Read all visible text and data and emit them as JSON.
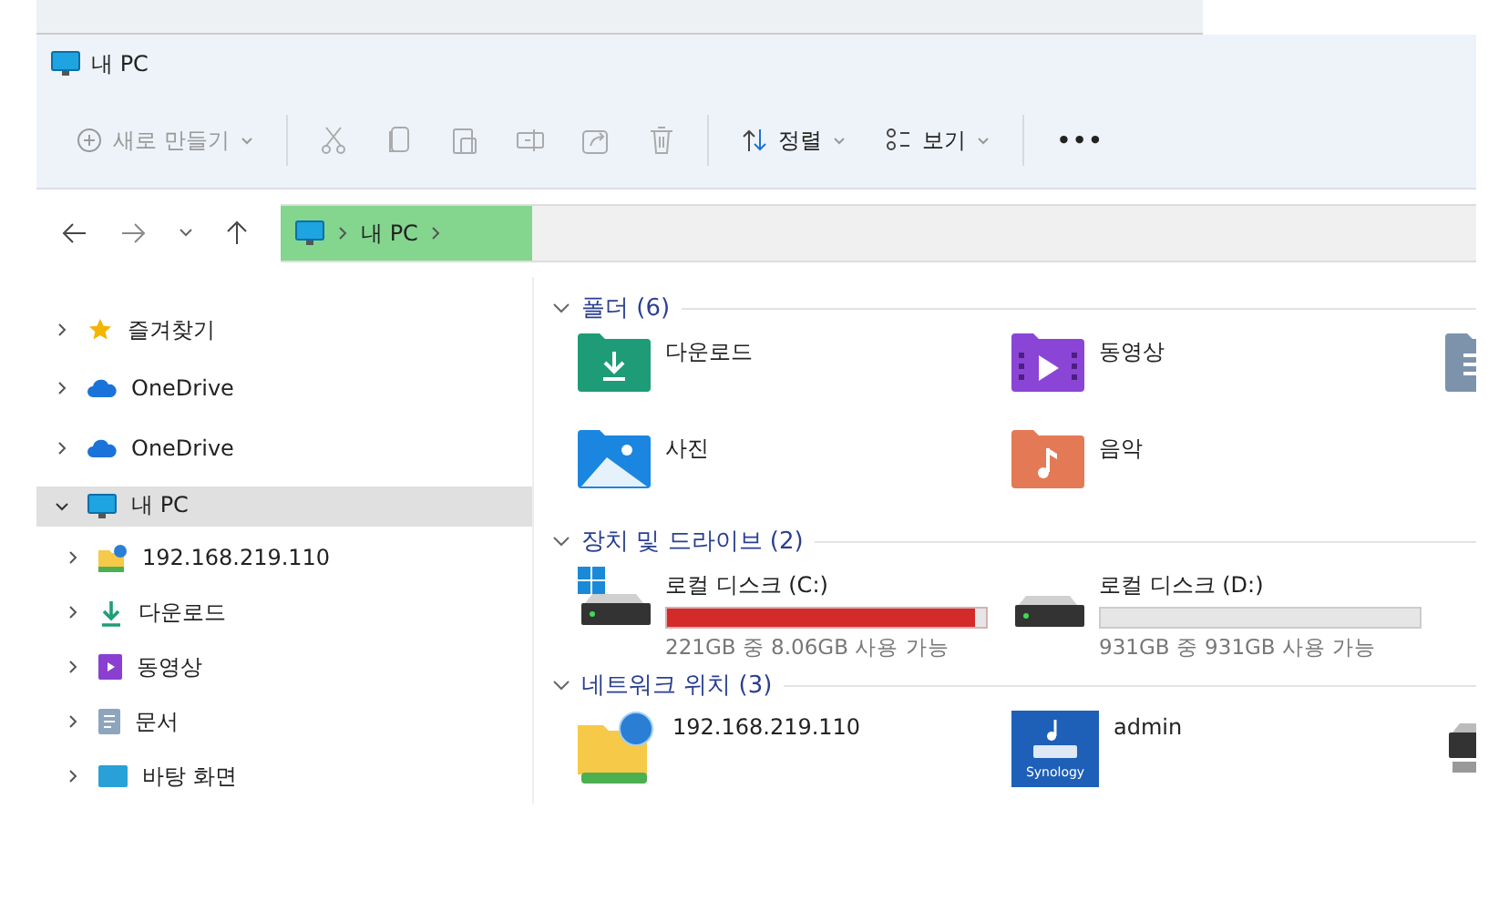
{
  "window": {
    "title": "내 PC"
  },
  "toolbar": {
    "new_button": "새로 만들기",
    "sort_button": "정렬",
    "view_button": "보기",
    "more_button": "•••"
  },
  "address_bar": {
    "path": [
      "내 PC"
    ]
  },
  "sidebar": {
    "items": [
      {
        "label": "즐겨찾기",
        "kind": "star",
        "expanded": false,
        "selected": false
      },
      {
        "label": "OneDrive",
        "kind": "cloud",
        "expanded": false,
        "selected": false
      },
      {
        "label": "OneDrive",
        "kind": "cloud",
        "expanded": false,
        "selected": false
      },
      {
        "label": "내 PC",
        "kind": "pc",
        "expanded": true,
        "selected": true,
        "children": [
          {
            "label": "192.168.219.110",
            "kind": "netfolder",
            "expanded": false,
            "selected": false
          },
          {
            "label": "다운로드",
            "kind": "download",
            "expanded": false,
            "selected": false
          },
          {
            "label": "동영상",
            "kind": "video",
            "expanded": false,
            "selected": false
          },
          {
            "label": "문서",
            "kind": "documents",
            "expanded": false,
            "selected": false
          },
          {
            "label": "바탕 화면",
            "kind": "desktop",
            "expanded": false,
            "selected": false
          }
        ]
      }
    ]
  },
  "sections": [
    {
      "title": "폴더 (6)",
      "kind": "folders",
      "items": [
        {
          "label": "다운로드",
          "kind": "download"
        },
        {
          "label": "동영상",
          "kind": "video"
        },
        {
          "kind": "documents"
        },
        {
          "label": "사진",
          "kind": "pictures"
        },
        {
          "label": "음악",
          "kind": "music"
        }
      ]
    },
    {
      "title": "장치 및 드라이브 (2)",
      "kind": "drives",
      "items": [
        {
          "label": "로컬 디스크 (C:)",
          "kind": "system",
          "level": 0.964,
          "free": "221GB 중 8.06GB 사용 가능",
          "warning": true
        },
        {
          "label": "로컬 디스크 (D:)",
          "kind": "disk",
          "level": 0.0,
          "free": "931GB 중 931GB 사용 가능",
          "warning": false
        }
      ]
    },
    {
      "title": "네트워크 위치 (3)",
      "kind": "network",
      "items": [
        {
          "label": "192.168.219.110",
          "kind": "netfolder"
        },
        {
          "label": "admin",
          "kind": "nas",
          "icon_label": "Synology"
        },
        {
          "kind": "netdrive"
        }
      ]
    }
  ]
}
